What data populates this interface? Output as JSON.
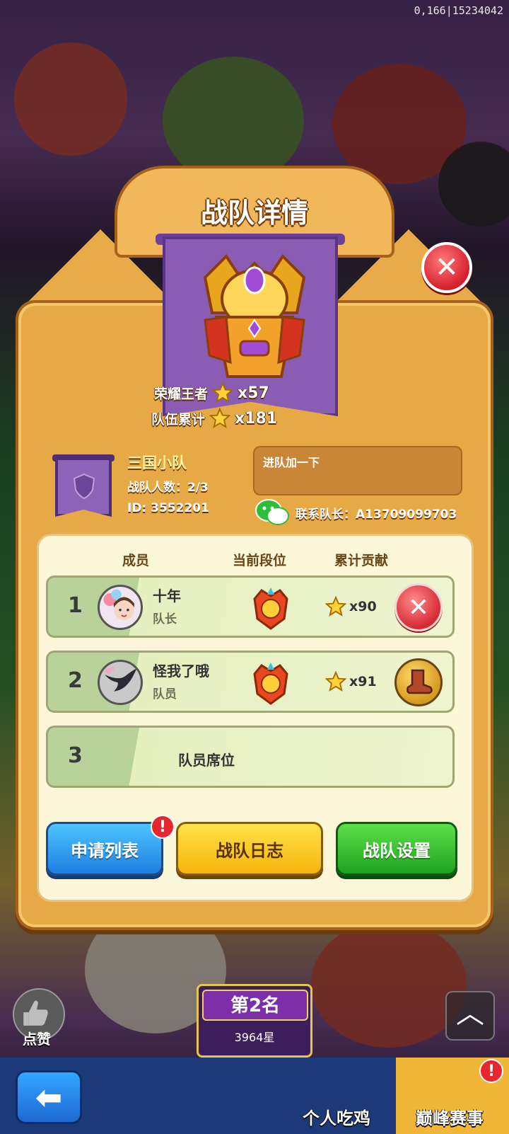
{
  "debug_id": "0,166|15234042",
  "modal": {
    "title": "战队详情",
    "glory_label": "荣耀王者",
    "glory_value": "x57",
    "team_total_label": "队伍累计",
    "team_total_value": "x181",
    "team_name": "三国小队",
    "member_count_label": "战队人数：2/3",
    "team_id": "ID: 3552201",
    "notice": "进队加一下",
    "contact": "联系队长：A13709099703",
    "columns": [
      "成员",
      "当前段位",
      "累计贡献"
    ],
    "members": [
      {
        "index": "1",
        "name": "十年",
        "role": "队长",
        "contribution": "x90"
      },
      {
        "index": "2",
        "name": "怪我了哦",
        "role": "队员",
        "contribution": "x91"
      }
    ],
    "empty_slot": {
      "index": "3",
      "label": "队员席位"
    },
    "buttons": {
      "apply_list": "申请列表",
      "team_log": "战队日志",
      "team_settings": "战队设置",
      "alert": "!"
    }
  },
  "hud": {
    "like_label": "点赞",
    "rank_title": "第2名",
    "rank_stars": "3964星",
    "tab_personal": "个人吃鸡",
    "tab_peak": "巅峰赛事",
    "tab_alert": "!"
  },
  "colors": {
    "panel": "#e7a846",
    "accent_purple": "#8a5cb3",
    "close_red": "#d61f2e"
  }
}
